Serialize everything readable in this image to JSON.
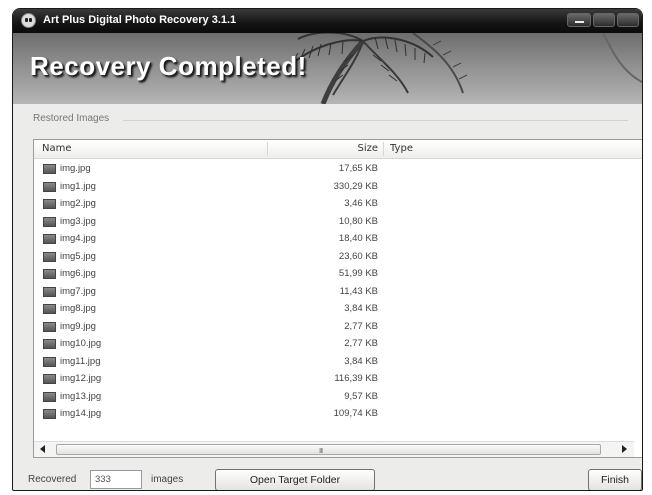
{
  "window": {
    "title": "Art Plus Digital Photo Recovery 3.1.1"
  },
  "banner": {
    "title": "Recovery Completed!"
  },
  "restored": {
    "group_label": "Restored Images",
    "columns": {
      "name": "Name",
      "size": "Size",
      "type": "Type"
    },
    "files": [
      {
        "name": "img.jpg",
        "size": "17,65 KB"
      },
      {
        "name": "img1.jpg",
        "size": "330,29 KB"
      },
      {
        "name": "img2.jpg",
        "size": "3,46 KB"
      },
      {
        "name": "img3.jpg",
        "size": "10,80 KB"
      },
      {
        "name": "img4.jpg",
        "size": "18,40 KB"
      },
      {
        "name": "img5.jpg",
        "size": "23,60 KB"
      },
      {
        "name": "img6.jpg",
        "size": "51,99 KB"
      },
      {
        "name": "img7.jpg",
        "size": "11,43 KB"
      },
      {
        "name": "img8.jpg",
        "size": "3,84 KB"
      },
      {
        "name": "img9.jpg",
        "size": "2,77 KB"
      },
      {
        "name": "img10.jpg",
        "size": "2,77 KB"
      },
      {
        "name": "img11.jpg",
        "size": "3,84 KB"
      },
      {
        "name": "img12.jpg",
        "size": "116,39 KB"
      },
      {
        "name": "img13.jpg",
        "size": "9,57 KB"
      },
      {
        "name": "img14.jpg",
        "size": "109,74 KB"
      }
    ],
    "hscroll_grip": "III"
  },
  "footer": {
    "recovered_label": "Recovered",
    "recovered_count": "333",
    "images_label": "images",
    "open_folder_button": "Open Target Folder",
    "finish_button": "Finish"
  },
  "colors": {
    "titlebar": "#141414",
    "window_bg": "#ececea",
    "banner_gray": "#8f8f8f"
  },
  "icons": {
    "app": "skull-icon",
    "file": "image-file-icon"
  }
}
